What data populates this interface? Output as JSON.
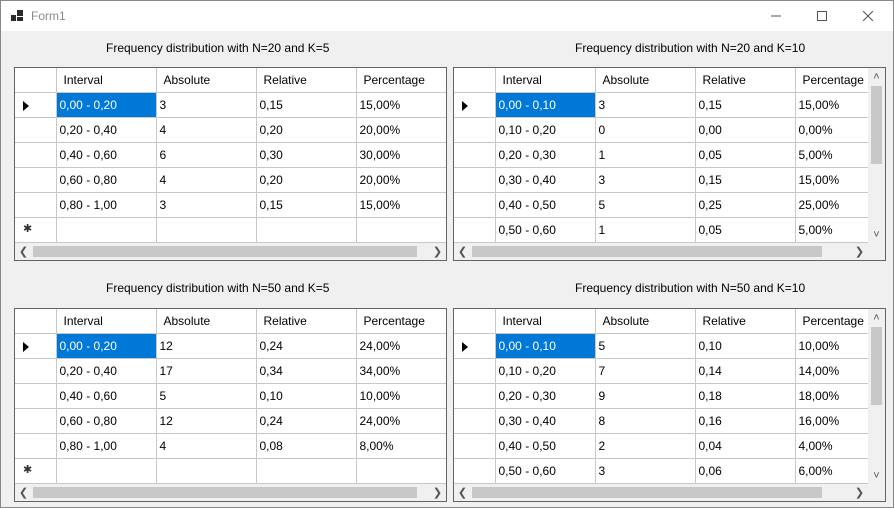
{
  "window": {
    "title": "Form1"
  },
  "columns": [
    "Interval",
    "Absolute",
    "Relative",
    "Percentage"
  ],
  "tables": [
    {
      "caption": "Frequency distribution with N=20 and K=5",
      "rows": [
        [
          "0,00 - 0,20",
          "3",
          "0,15",
          "15,00%"
        ],
        [
          "0,20 - 0,40",
          "4",
          "0,20",
          "20,00%"
        ],
        [
          "0,40 - 0,60",
          "6",
          "0,30",
          "30,00%"
        ],
        [
          "0,60 - 0,80",
          "4",
          "0,20",
          "20,00%"
        ],
        [
          "0,80 - 1,00",
          "3",
          "0,15",
          "15,00%"
        ]
      ]
    },
    {
      "caption": "Frequency distribution with N=20 and K=10",
      "rows": [
        [
          "0,00 - 0,10",
          "3",
          "0,15",
          "15,00%"
        ],
        [
          "0,10 - 0,20",
          "0",
          "0,00",
          "0,00%"
        ],
        [
          "0,20 - 0,30",
          "1",
          "0,05",
          "5,00%"
        ],
        [
          "0,30 - 0,40",
          "3",
          "0,15",
          "15,00%"
        ],
        [
          "0,40 - 0,50",
          "5",
          "0,25",
          "25,00%"
        ],
        [
          "0,50 - 0,60",
          "1",
          "0,05",
          "5,00%"
        ]
      ]
    },
    {
      "caption": "Frequency distribution with N=50 and K=5",
      "rows": [
        [
          "0,00 - 0,20",
          "12",
          "0,24",
          "24,00%"
        ],
        [
          "0,20 - 0,40",
          "17",
          "0,34",
          "34,00%"
        ],
        [
          "0,40 - 0,60",
          "5",
          "0,10",
          "10,00%"
        ],
        [
          "0,60 - 0,80",
          "12",
          "0,24",
          "24,00%"
        ],
        [
          "0,80 - 1,00",
          "4",
          "0,08",
          "8,00%"
        ]
      ]
    },
    {
      "caption": "Frequency distribution with N=50 and K=10",
      "rows": [
        [
          "0,00 - 0,10",
          "5",
          "0,10",
          "10,00%"
        ],
        [
          "0,10 - 0,20",
          "7",
          "0,14",
          "14,00%"
        ],
        [
          "0,20 - 0,30",
          "9",
          "0,18",
          "18,00%"
        ],
        [
          "0,30 - 0,40",
          "8",
          "0,16",
          "16,00%"
        ],
        [
          "0,40 - 0,50",
          "2",
          "0,04",
          "4,00%"
        ],
        [
          "0,50 - 0,60",
          "3",
          "0,06",
          "6,00%"
        ]
      ]
    }
  ],
  "colors": {
    "selection": "#0078d7",
    "gridline": "#c8c8c8",
    "background": "#f0f0f0"
  }
}
